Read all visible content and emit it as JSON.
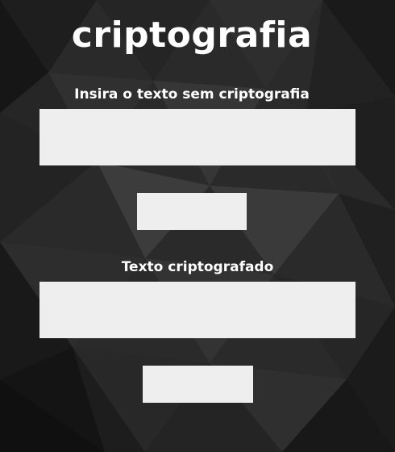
{
  "app": {
    "title": "criptografia"
  },
  "encrypt": {
    "label": "Insira o texto sem criptografia",
    "input_value": "",
    "button_label": ""
  },
  "result": {
    "label": "Texto criptografado",
    "output_value": "",
    "button_label": ""
  },
  "colors": {
    "background": "#262626",
    "text": "#ffffff",
    "field": "#eeeeee"
  }
}
